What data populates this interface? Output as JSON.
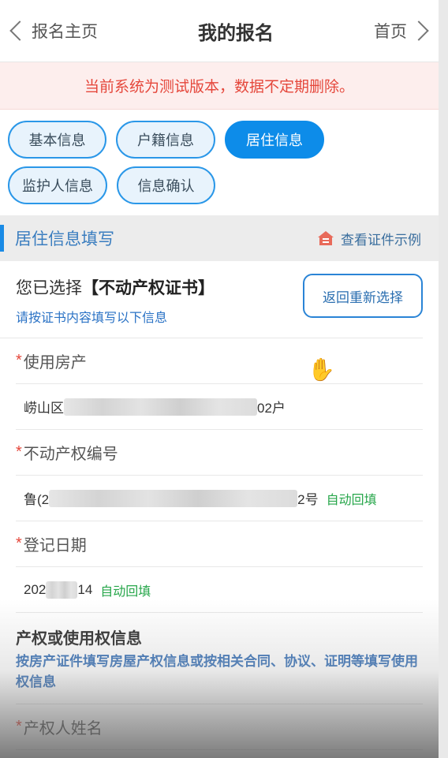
{
  "header": {
    "back_label": "报名主页",
    "title": "我的报名",
    "home_label": "首页"
  },
  "notice": "当前系统为测试版本，数据不定期删除。",
  "tabs": [
    {
      "label": "基本信息",
      "active": false
    },
    {
      "label": "户籍信息",
      "active": false
    },
    {
      "label": "居住信息",
      "active": true
    },
    {
      "label": "监护人信息",
      "active": false
    },
    {
      "label": "信息确认",
      "active": false
    }
  ],
  "section": {
    "title": "居住信息填写",
    "example_link": "查看证件示例"
  },
  "selection": {
    "prefix": "您已选择",
    "choice": "【不动产权证书】",
    "hint": "请按证书内容填写以下信息",
    "reselect_label": "返回重新选择"
  },
  "fields": {
    "property": {
      "label": "使用房产",
      "value_start": "崂山区",
      "value_end": "02户"
    },
    "cert_no": {
      "label": "不动产权编号",
      "value_start": "鲁(2",
      "value_end": "2号",
      "auto": "自动回填"
    },
    "reg_date": {
      "label": "登记日期",
      "value_start": "202",
      "value_end": "14",
      "auto": "自动回填"
    }
  },
  "rights": {
    "title": "产权或使用权信息",
    "desc": "按房产证件填写房屋产权信息或按相关合同、协议、证明等填写使用权信息"
  },
  "owner_name_label": "产权人姓名",
  "colors": {
    "accent": "#0d8ce9",
    "warning": "#e5473b",
    "auto_fill": "#26a64a"
  }
}
